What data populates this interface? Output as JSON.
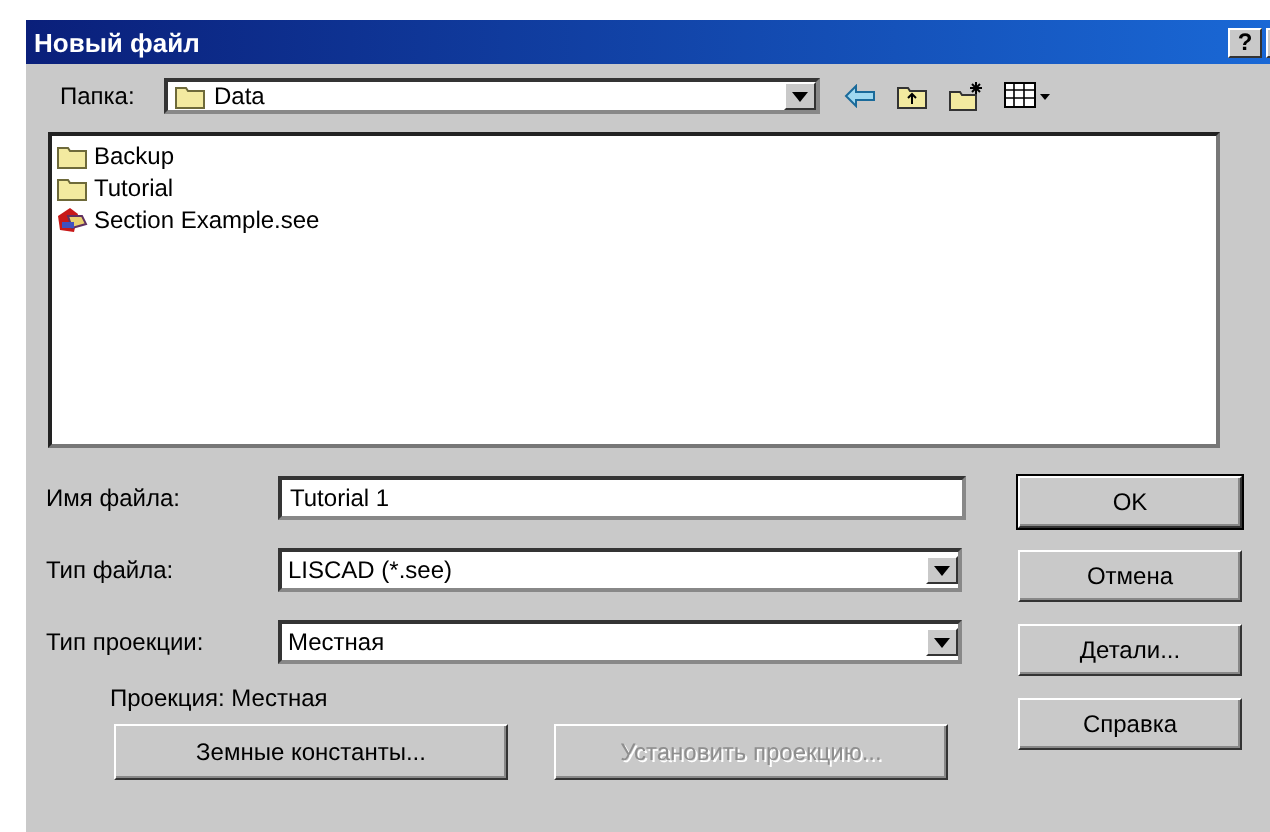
{
  "window": {
    "title": "Новый файл",
    "help_button": "?"
  },
  "look_in": {
    "label": "Папка:",
    "value": "Data"
  },
  "files": [
    {
      "name": "Backup",
      "kind": "folder"
    },
    {
      "name": "Tutorial",
      "kind": "folder"
    },
    {
      "name": "Section Example.see",
      "kind": "document"
    }
  ],
  "fields": [
    {
      "label": "Имя файла:",
      "value": "Tutorial 1",
      "kind": "text"
    },
    {
      "label": "Тип файла:",
      "value": "LISCAD  (*.see)",
      "kind": "combo"
    },
    {
      "label": "Тип проекции:",
      "value": "Местная",
      "kind": "combo"
    }
  ],
  "projection_note": "Проекция: Местная",
  "side_buttons": [
    {
      "label": "OK",
      "default": true
    },
    {
      "label": "Отмена",
      "default": false
    },
    {
      "label": "Детали...",
      "default": false
    },
    {
      "label": "Справка",
      "default": false
    }
  ],
  "bottom_buttons": [
    {
      "label": "Земные константы...",
      "disabled": false
    },
    {
      "label": "Установить проекцию...",
      "disabled": true
    }
  ]
}
